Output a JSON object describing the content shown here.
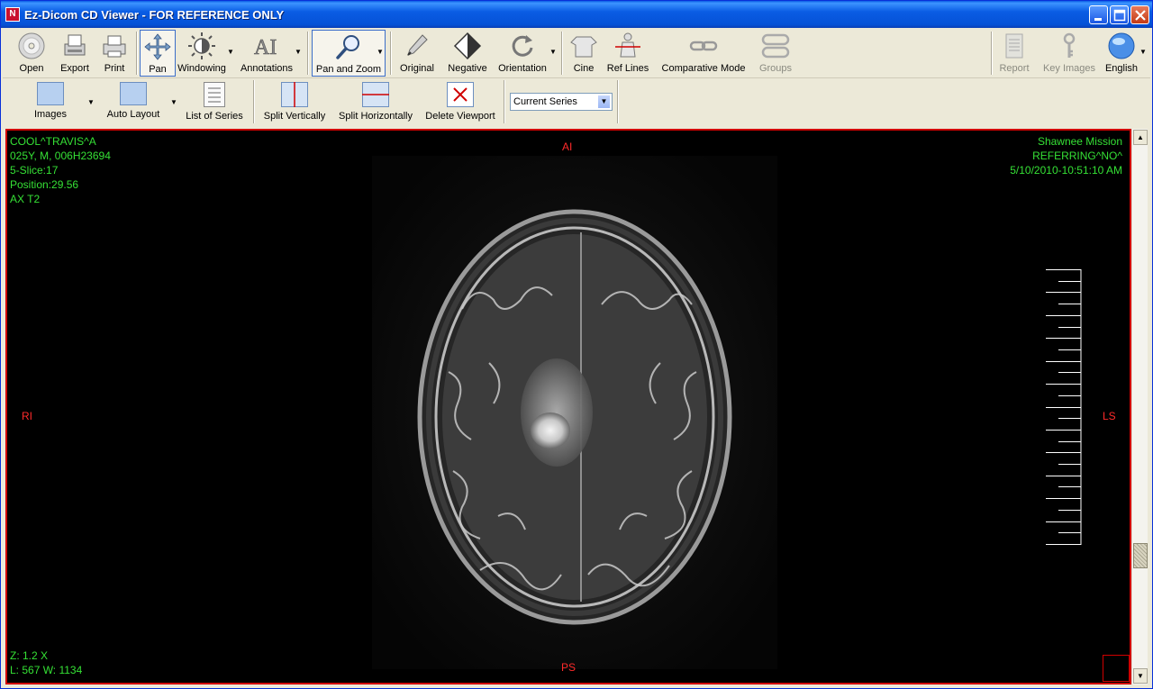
{
  "window": {
    "title": "Ez-Dicom CD Viewer - FOR REFERENCE ONLY",
    "icon_label": "N"
  },
  "toolbar_main": {
    "open": "Open",
    "export": "Export",
    "print": "Print",
    "pan": "Pan",
    "windowing": "Windowing",
    "annotations": "Annotations",
    "pan_and_zoom": "Pan and Zoom",
    "original": "Original",
    "negative": "Negative",
    "orientation": "Orientation",
    "cine": "Cine",
    "ref_lines": "Ref Lines",
    "comparative_mode": "Comparative Mode",
    "groups": "Groups",
    "report": "Report",
    "key_images": "Key Images",
    "language": "English"
  },
  "toolbar_layout": {
    "images": "Images",
    "auto_layout": "Auto Layout",
    "list_of_series": "List of Series",
    "split_vertically": "Split Vertically",
    "split_horizontally": "Split Horizontally",
    "delete_viewport": "Delete Viewport",
    "series_scope": "Current Series"
  },
  "overlay": {
    "patient_name": "COOL^TRAVIS^A",
    "patient_info": "025Y, M, 006H23694",
    "slice": "5-Slice:17",
    "position": "Position:29.56",
    "sequence": "AX T2",
    "institution": "Shawnee Mission",
    "referring": "REFERRING^NO^",
    "datetime": "5/10/2010-10:51:10 AM",
    "zoom": "Z: 1.2 X",
    "window_level": "L: 567 W: 1134",
    "orient_top": "AI",
    "orient_bottom": "PS",
    "orient_left": "RI",
    "orient_right": "LS"
  },
  "colors": {
    "overlay_text": "#35e035",
    "orientation_text": "#ff2a2a",
    "viewport_border": "#d00000"
  }
}
